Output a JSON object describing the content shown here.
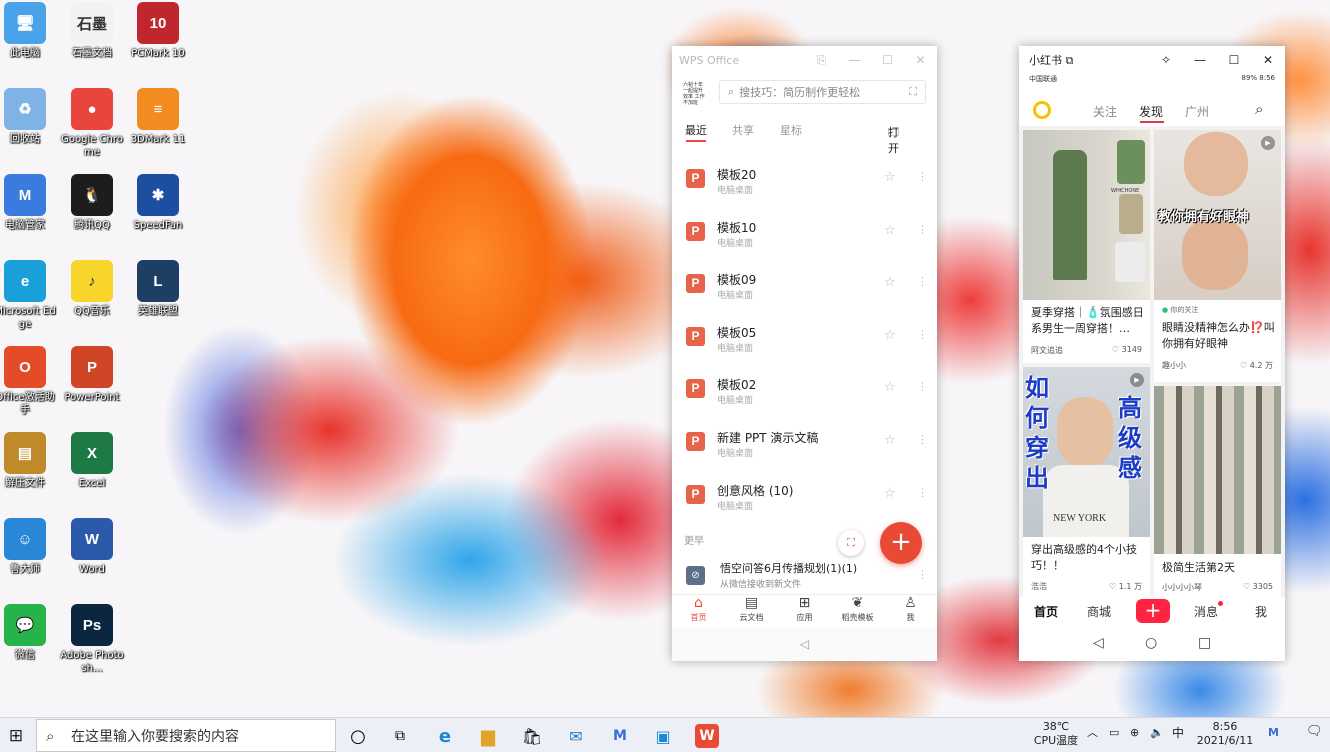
{
  "desktop": {
    "icons": [
      {
        "label": "此电脑",
        "glyph": "🖥",
        "bg": "#4aa3e8"
      },
      {
        "label": "石墨文档",
        "glyph": "石墨",
        "bg": "#f2f2f2"
      },
      {
        "label": "PCMark 10",
        "glyph": "10",
        "bg": "#c0262e"
      },
      {
        "label": "回收站",
        "glyph": "♻",
        "bg": "#7fb3e6"
      },
      {
        "label": "Google Chrome",
        "glyph": "●",
        "bg": "#e8453c"
      },
      {
        "label": "3DMark 11",
        "glyph": "≡",
        "bg": "#f28b20"
      },
      {
        "label": "电脑管家",
        "glyph": "M",
        "bg": "#3a7be0"
      },
      {
        "label": "腾讯QQ",
        "glyph": "🐧",
        "bg": "#1d1d1d"
      },
      {
        "label": "SpeedFan",
        "glyph": "✱",
        "bg": "#1c4fa0"
      },
      {
        "label": "Microsoft Edge",
        "glyph": "e",
        "bg": "#1aa0d8"
      },
      {
        "label": "QQ音乐",
        "glyph": "♪",
        "bg": "#f7d52a"
      },
      {
        "label": "英雄联盟",
        "glyph": "L",
        "bg": "#1f3e63"
      },
      {
        "label": "Office激活助手",
        "glyph": "O",
        "bg": "#e34c26"
      },
      {
        "label": "PowerPoint",
        "glyph": "P",
        "bg": "#d04526"
      },
      {
        "label": "解压文件",
        "glyph": "▤",
        "bg": "#c08a2a"
      },
      {
        "label": "Excel",
        "glyph": "X",
        "bg": "#1d7a45"
      },
      {
        "label": "鲁大师",
        "glyph": "☺",
        "bg": "#2a86d6"
      },
      {
        "label": "Word",
        "glyph": "W",
        "bg": "#2b5aab"
      },
      {
        "label": "微信",
        "glyph": "💬",
        "bg": "#26b34a"
      },
      {
        "label": "Adobe Photosh...",
        "glyph": "Ps",
        "bg": "#0b2740"
      }
    ]
  },
  "wps": {
    "title": "WPS Office",
    "logo_text": "六韬十年 一起提升效率 工作不加班",
    "search_placeholder": "搜技巧：简历制作更轻松",
    "tabs": [
      "最近",
      "共享",
      "星标"
    ],
    "open_label": "打开",
    "files": [
      {
        "name": "模板20",
        "loc": "电脑桌面"
      },
      {
        "name": "模板10",
        "loc": "电脑桌面"
      },
      {
        "name": "模板09",
        "loc": "电脑桌面"
      },
      {
        "name": "模板05",
        "loc": "电脑桌面"
      },
      {
        "name": "模板02",
        "loc": "电脑桌面"
      },
      {
        "name": "新建 PPT 演示文稿",
        "loc": "电脑桌面"
      },
      {
        "name": "创意风格 (10)",
        "loc": "电脑桌面"
      }
    ],
    "section_earlier": "更早",
    "earlier_file": {
      "name": "悟空问答6月传播规划(1)(1)",
      "loc": "从微信接收到新文件"
    },
    "nav": [
      {
        "label": "首页",
        "icon": "home-icon"
      },
      {
        "label": "云文档",
        "icon": "cloud-doc-icon"
      },
      {
        "label": "应用",
        "icon": "apps-icon"
      },
      {
        "label": "稻壳模板",
        "icon": "template-icon"
      },
      {
        "label": "我",
        "icon": "user-icon"
      }
    ]
  },
  "xhs": {
    "title": "小红书",
    "status_left": "中国联通",
    "status_right": "89% 8:56",
    "tabs": [
      "关注",
      "发现",
      "广州"
    ],
    "cards": [
      {
        "title": "夏季穿搭｜🧴氛围感日系男生一周穿搭！…",
        "author": "阿文追追",
        "likes": "3149",
        "img_text": "WHICHONE"
      },
      {
        "title": "眼睛没精神怎么办⁉️叫你拥有好眼神",
        "author": "趣小小",
        "likes": "4.2 万",
        "tag": "你的关注",
        "img_text": "教你拥有好眼神"
      },
      {
        "title": "穿出高级感的4个小技巧！！",
        "author": "浩浩",
        "likes": "1.1 万",
        "img_left": "如何穿出",
        "img_right": "高级感",
        "img_shirt": "NEW YORK"
      },
      {
        "title": "极简生活第2天",
        "author": "小小小小琴",
        "likes": "3305"
      }
    ],
    "nav": [
      "首页",
      "商城",
      "消息",
      "我"
    ]
  },
  "taskbar": {
    "search_placeholder": "在这里输入你要搜索的内容",
    "temp": "38℃",
    "temp_label": "CPU温度",
    "time": "8:56",
    "date": "2021/6/11",
    "ime": "中"
  }
}
